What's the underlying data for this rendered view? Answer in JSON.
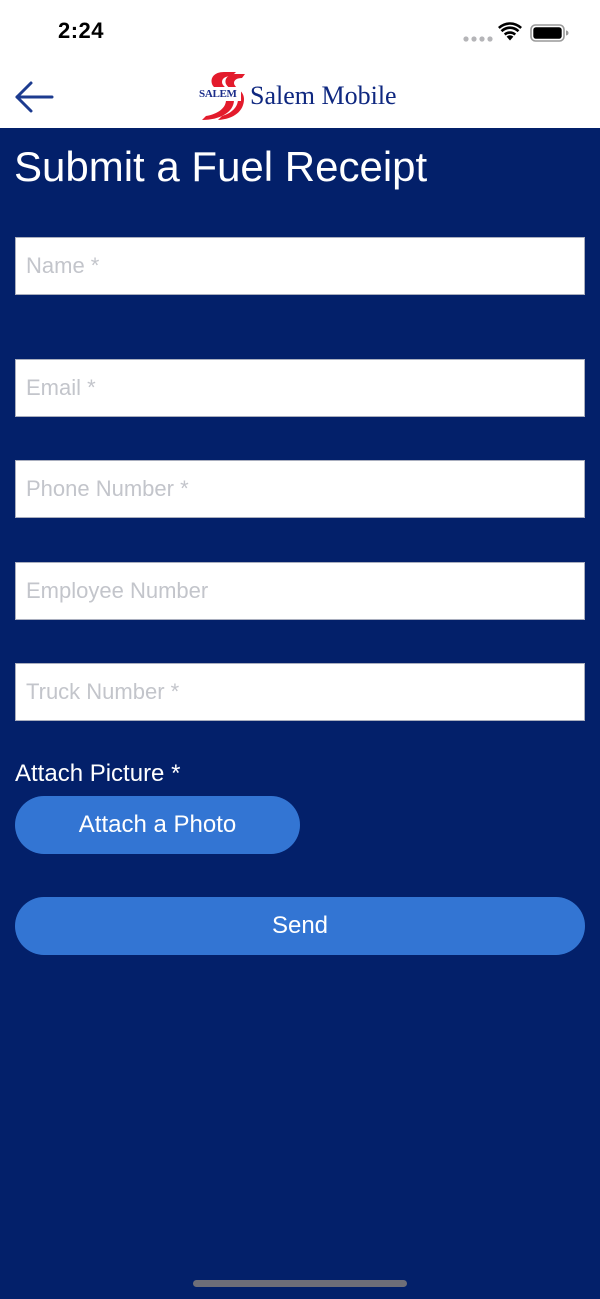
{
  "status_bar": {
    "time": "2:24",
    "icons": [
      "signal-dots-icon",
      "wifi-icon",
      "battery-icon"
    ]
  },
  "nav": {
    "back_icon": "arrow-left-icon",
    "logo_text": "SALEM",
    "brand_name": "Salem Mobile"
  },
  "form": {
    "title": "Submit a Fuel Receipt",
    "fields": [
      {
        "value": "",
        "placeholder": "Name *"
      },
      {
        "value": "",
        "placeholder": "Email *"
      },
      {
        "value": "",
        "placeholder": "Phone Number *"
      },
      {
        "value": "",
        "placeholder": "Employee Number"
      },
      {
        "value": "",
        "placeholder": "Truck Number *"
      }
    ],
    "attach_label": "Attach Picture *",
    "attach_button": "Attach a Photo",
    "send_button": "Send"
  },
  "colors": {
    "background": "#03206a",
    "button": "#3375d3",
    "logo_red": "#e31b2c"
  }
}
